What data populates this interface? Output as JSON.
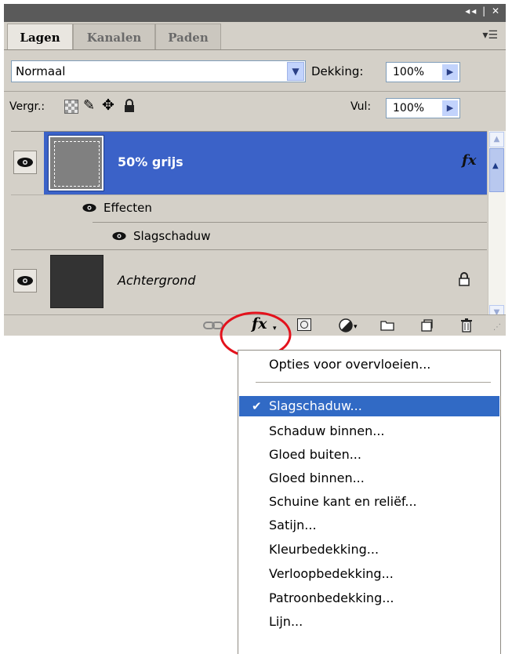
{
  "panel": {
    "tabs": [
      {
        "label": "Lagen",
        "active": true
      },
      {
        "label": "Kanalen",
        "active": false
      },
      {
        "label": "Paden",
        "active": false
      }
    ],
    "blend_mode": "Normaal",
    "opacity_label": "Dekking:",
    "opacity_value": "100%",
    "lock_label": "Vergr.:",
    "fill_label": "Vul:",
    "fill_value": "100%"
  },
  "layers": [
    {
      "name": "50% grijs",
      "selected": true,
      "fx_badge": "fx",
      "effects_label": "Effecten",
      "effect_items": [
        "Slagschaduw"
      ]
    },
    {
      "name": "Achtergrond",
      "selected": false,
      "locked": true
    }
  ],
  "footer": {
    "fx_button": "fx"
  },
  "dropdown": {
    "items": [
      {
        "label": "Opties voor overvloeien...",
        "checked": false,
        "highlighted": false
      },
      {
        "label": "Slagschaduw...",
        "checked": true,
        "highlighted": true
      },
      {
        "label": "Schaduw binnen...",
        "checked": false,
        "highlighted": false
      },
      {
        "label": "Gloed buiten...",
        "checked": false,
        "highlighted": false
      },
      {
        "label": "Gloed binnen...",
        "checked": false,
        "highlighted": false
      },
      {
        "label": "Schuine kant en reliëf...",
        "checked": false,
        "highlighted": false
      },
      {
        "label": "Satijn...",
        "checked": false,
        "highlighted": false
      },
      {
        "label": "Kleurbedekking...",
        "checked": false,
        "highlighted": false
      },
      {
        "label": "Verloopbedekking...",
        "checked": false,
        "highlighted": false
      },
      {
        "label": "Patroonbedekking...",
        "checked": false,
        "highlighted": false
      },
      {
        "label": "Lijn...",
        "checked": false,
        "highlighted": false
      }
    ]
  },
  "colors": {
    "selection": "#3b62c8",
    "menu_highlight": "#316ac5",
    "annotation_circle": "#e3121c"
  },
  "icons": [
    "eye-icon",
    "link-icon",
    "fx-icon",
    "mask-icon",
    "adjustment-icon",
    "folder-icon",
    "new-layer-icon",
    "trash-icon",
    "lock-icon",
    "checkmark-icon"
  ]
}
